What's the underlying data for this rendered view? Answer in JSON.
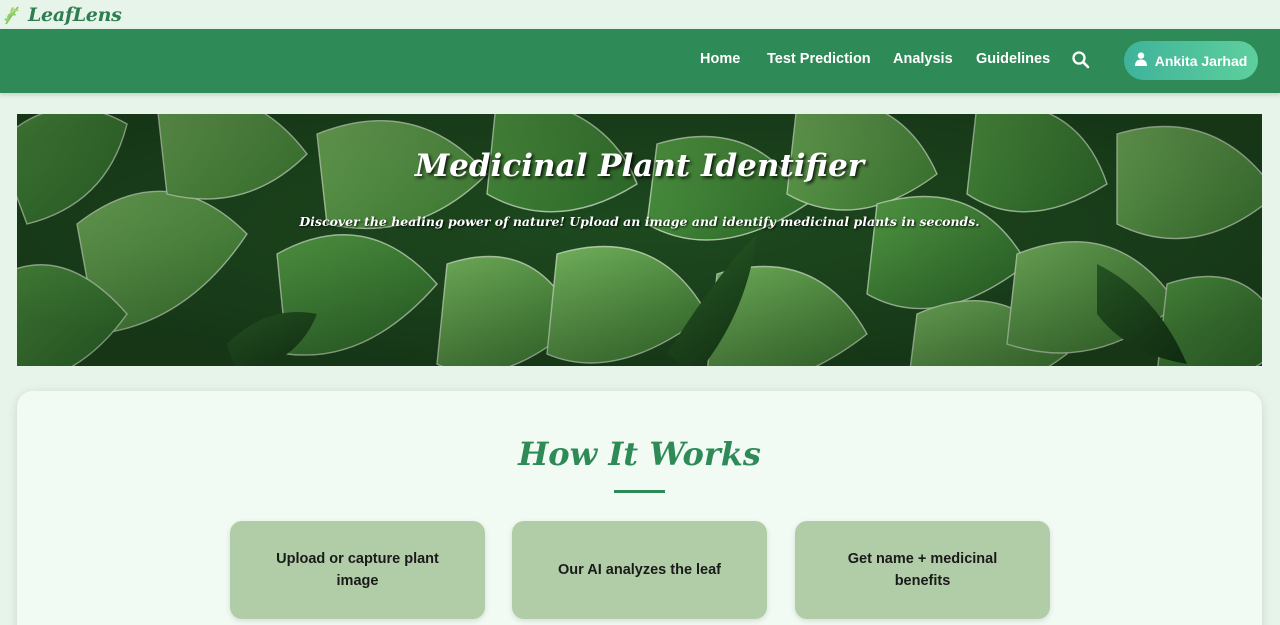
{
  "brand": {
    "name": "LeafLens",
    "icon": "leaf-sprig-icon",
    "color": "#2e7d50"
  },
  "nav": {
    "links": [
      "Home",
      "Test Prediction",
      "Analysis",
      "Guidelines"
    ],
    "search_icon": "search-icon",
    "user": {
      "name": "Ankita Jarhad",
      "icon": "user-icon"
    },
    "bg_color": "#2e8b57"
  },
  "hero": {
    "title": "Medicinal Plant Identifier",
    "subtitle": "Discover the healing power of nature! Upload an image and identify medicinal plants in seconds."
  },
  "how_it_works": {
    "title": "How It Works",
    "steps": [
      "Upload or capture plant image",
      "Our AI analyzes the leaf",
      "Get name + medicinal benefits"
    ]
  }
}
